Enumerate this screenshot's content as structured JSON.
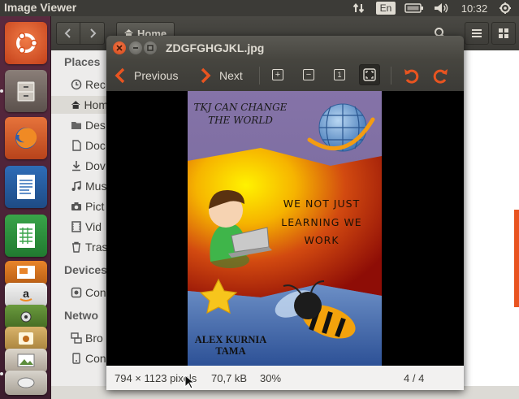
{
  "topbar": {
    "app_title": "Image Viewer",
    "keyboard_layout": "En",
    "clock": "10:32"
  },
  "files": {
    "location_button": "Home",
    "sidebar": {
      "places_heading": "Places",
      "items": [
        "Rec",
        "Hom",
        "Des",
        "Doc",
        "Dov",
        "Mus",
        "Pict",
        "Vid",
        "Tras"
      ],
      "devices_heading": "Devices",
      "device_items": [
        "Con"
      ],
      "network_heading": "Netwo",
      "network_items": [
        "Bro",
        "Con"
      ]
    }
  },
  "viewer": {
    "filename": "ZDGFGHGJKL.jpg",
    "toolbar": {
      "previous_label": "Previous",
      "next_label": "Next"
    },
    "status": {
      "dimensions": "794 × 1123 pixels",
      "filesize": "70,7 kB",
      "zoom": "30%",
      "position": "4 / 4"
    },
    "image": {
      "top_text_line1": "TKJ CAN CHANGE",
      "top_text_line2": "THE WORLD",
      "middle_line1": "WE NOT JUST",
      "middle_line2": "LEARNING WE",
      "middle_line3": "WORK",
      "author_line1": "ALEX KURNIA",
      "author_line2": "TAMA"
    }
  },
  "colors": {
    "launcher_bg": "#4a2237",
    "accent_orange": "#e95420",
    "window_dark": "#3c3b37"
  }
}
